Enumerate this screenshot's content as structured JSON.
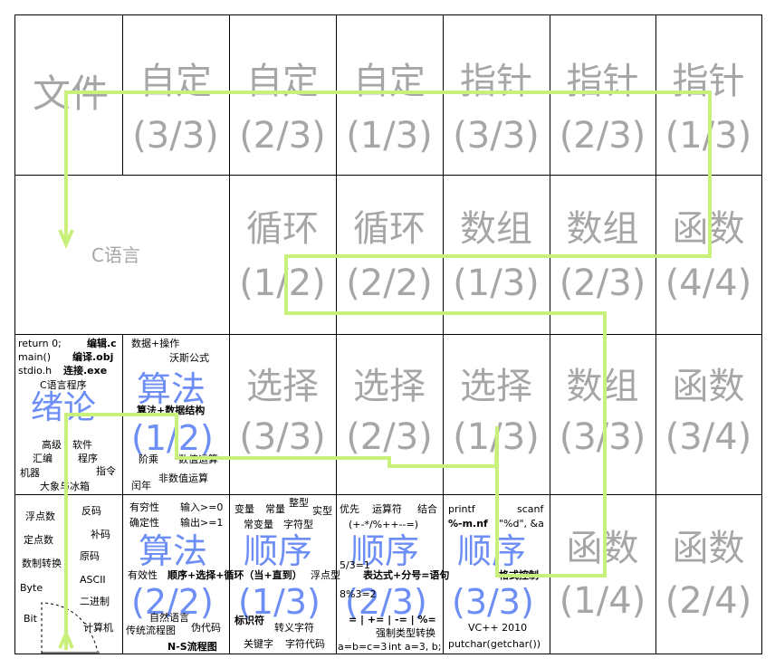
{
  "wenjian": "文件",
  "c_lang": "C语言",
  "row1": [
    {
      "t": "自定",
      "f": "(3/3)"
    },
    {
      "t": "自定",
      "f": "(2/3)"
    },
    {
      "t": "自定",
      "f": "(1/3)"
    },
    {
      "t": "指针",
      "f": "(3/3)"
    },
    {
      "t": "指针",
      "f": "(2/3)"
    },
    {
      "t": "指针",
      "f": "(1/3)"
    }
  ],
  "row2": [
    {
      "t": "循环",
      "f": "(1/2)"
    },
    {
      "t": "循环",
      "f": "(2/2)"
    },
    {
      "t": "数组",
      "f": "(1/3)"
    },
    {
      "t": "数组",
      "f": "(2/3)"
    },
    {
      "t": "函数",
      "f": "(4/4)"
    }
  ],
  "row3": [
    {
      "t": "选择",
      "f": "(3/3)"
    },
    {
      "t": "选择",
      "f": "(2/3)"
    },
    {
      "t": "选择",
      "f": "(1/3)"
    },
    {
      "t": "数组",
      "f": "(3/3)"
    },
    {
      "t": "函数",
      "f": "(3/4)"
    }
  ],
  "row4": [
    {
      "t": "函数",
      "f": "(1/4)"
    },
    {
      "t": "函数",
      "f": "(2/4)"
    }
  ],
  "intro": {
    "title": "绪论",
    "notes": [
      "return 0;",
      "编辑.c",
      "main()",
      "编译.obj",
      "stdio.h",
      "连接.exe",
      "C语言程序",
      "高级",
      "软件",
      "汇编",
      "程序",
      "机器",
      "指令",
      "大象与冰箱"
    ]
  },
  "algo1": {
    "title": "算法",
    "frac": "(1/2)",
    "notes": [
      "数据+操作",
      "沃斯公式",
      "算法+数据结构",
      "阶乘",
      "数值运算",
      "非数值运算",
      "闰年"
    ]
  },
  "data_cell": {
    "notes": [
      "浮点数",
      "反码",
      "补码",
      "定点数",
      "原码",
      "数制转换",
      "ASCII",
      "Byte",
      "二进制",
      "Bit",
      "计算机"
    ]
  },
  "algo2": {
    "title": "算法",
    "frac": "(2/2)",
    "notes": [
      "有穷性",
      "输入>=0",
      "确定性",
      "输出>=1",
      "有效性",
      "顺序+选择+循环（当+直到）",
      "自然语言",
      "传统流程图",
      "伪代码",
      "N-S流程图"
    ]
  },
  "seq1": {
    "title": "顺序",
    "frac": "(1/3)",
    "notes": [
      "变量",
      "常量",
      "整型",
      "实型",
      "常变量",
      "字符型",
      "浮点型",
      "标识符",
      "转义字符",
      "关键字",
      "字符代码"
    ]
  },
  "seq2": {
    "title": "顺序",
    "frac": "(2/3)",
    "notes": [
      "优先",
      "运算符",
      "结合",
      "(+-*/%++--=)",
      "5/3=1",
      "表达式+分号=语句",
      "8%3=2",
      "= | += | -= | %=",
      "强制类型转换",
      "a=b=c=3",
      "int a=3, b;"
    ]
  },
  "seq3": {
    "title": "顺序",
    "frac": "(3/3)",
    "notes": [
      "printf",
      "scanf",
      "%-m.nf",
      "\"%d\", &a",
      "格式控制",
      "VC++ 2010",
      "putchar(getchar())"
    ]
  },
  "colors": {
    "path": "#c9f07a",
    "blue": "#6d8ef4",
    "gray": "#a6a6a6"
  }
}
